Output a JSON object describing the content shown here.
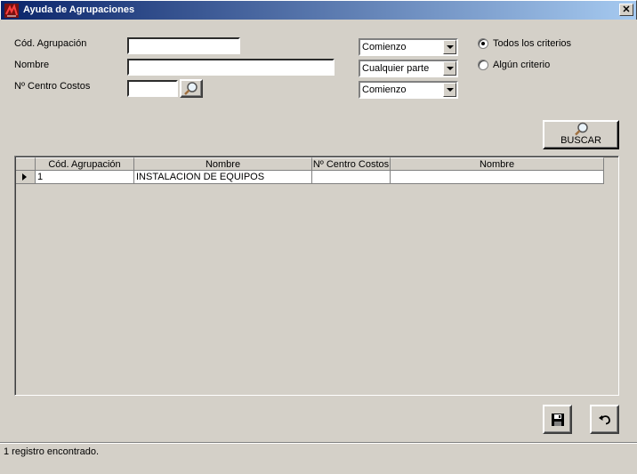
{
  "window": {
    "title": "Ayuda de Agrupaciones",
    "close_symbol": "✕"
  },
  "form": {
    "cod_label": "Cód. Agrupación",
    "cod_value": "",
    "cod_match": "Comienzo",
    "nombre_label": "Nombre",
    "nombre_value": "",
    "nombre_match": "Cualquier parte",
    "centro_label": "Nº Centro Costos",
    "centro_value": "",
    "centro_match": "Comienzo"
  },
  "criteria": {
    "all_label": "Todos los criterios",
    "any_label": "Algún criterio",
    "selected": "all"
  },
  "search_button": {
    "label": "BUSCAR"
  },
  "grid": {
    "columns": [
      "Cód. Agrupación",
      "Nombre",
      "Nº Centro Costos",
      "Nombre"
    ],
    "rows": [
      {
        "cod": "1",
        "nombre": "INSTALACION DE EQUIPOS",
        "centro": "",
        "centro_nombre": ""
      }
    ]
  },
  "actions": {
    "save_icon": "save-icon",
    "undo_icon": "undo-icon"
  },
  "status": {
    "text": "1 registro encontrado."
  }
}
